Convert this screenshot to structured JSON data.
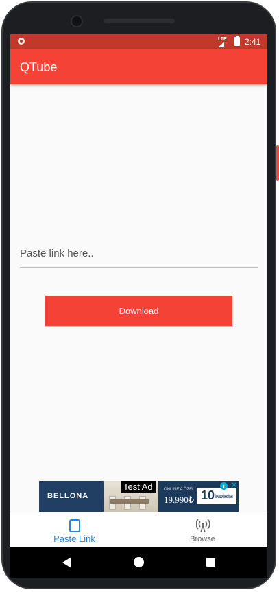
{
  "status_bar": {
    "network": "LTE",
    "time": "2:41"
  },
  "app_bar": {
    "title": "QTube"
  },
  "main": {
    "link_input": {
      "placeholder": "Paste link here..",
      "value": ""
    },
    "download_label": "Download"
  },
  "ad": {
    "label": "Test Ad",
    "brand": "BELLONA",
    "online_text": "ONLİNE'A ÖZEL",
    "price": "19.990₺",
    "discount_num": "10",
    "discount_text": "İNDİRİM",
    "info_icon": "info-icon",
    "close_icon": "close-icon"
  },
  "bottom_nav": {
    "items": [
      {
        "label": "Paste Link",
        "icon": "clipboard-icon",
        "active": true
      },
      {
        "label": "Browse",
        "icon": "broadcast-icon",
        "active": false
      }
    ]
  },
  "colors": {
    "primary": "#f44336",
    "status_bar": "#c0392b",
    "active_nav": "#1e88e5"
  }
}
